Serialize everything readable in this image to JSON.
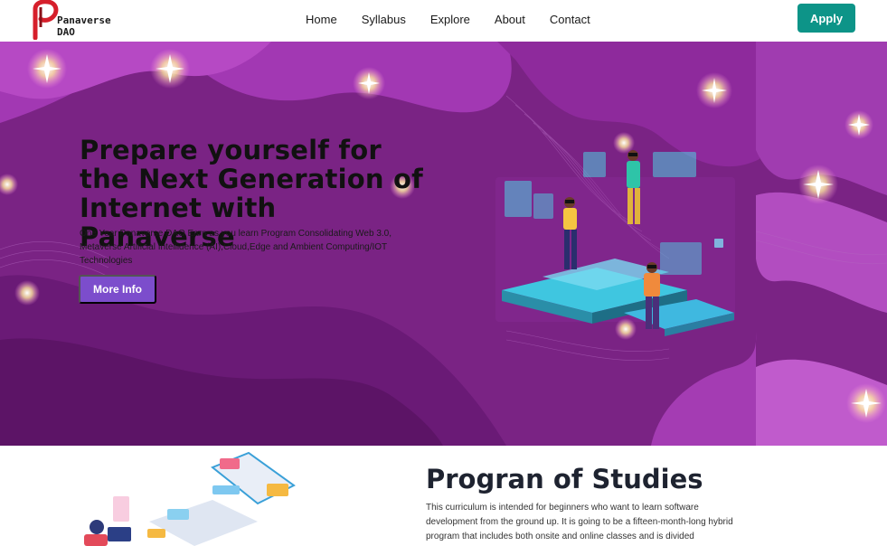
{
  "brand": {
    "line1": "Panaverse",
    "line2": "DAO"
  },
  "nav": {
    "items": [
      "Home",
      "Syllabus",
      "Explore",
      "About",
      "Contact"
    ],
    "apply_label": "Apply"
  },
  "hero": {
    "title": "Prepare yourself for the Next Generation of Internet with Panaverse",
    "subtitle": "One Year Panaverse DAO Earn as you learn Program Consolidating Web 3.0, Metaverse Artificial Intellidence (AI),Cloud,Edge and Ambient Computing/IOT Technologies",
    "button_label": "More Info"
  },
  "program": {
    "title": "Progran of Studies",
    "text": "This curriculum is intended for beginners who want to learn software development from the ground up. It is going to be a fifteen-month-long hybrid program that includes both onsite and online classes and is divided"
  },
  "colors": {
    "hero_bg": "#7a2384",
    "apply": "#0d9488",
    "more_info": "#7c4dcc"
  }
}
